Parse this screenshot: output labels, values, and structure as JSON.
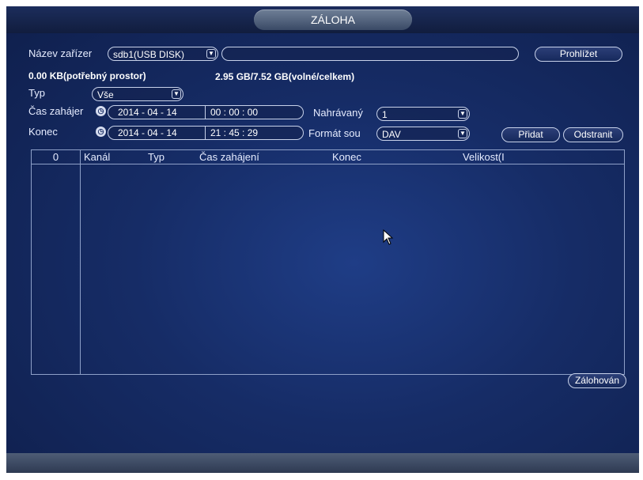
{
  "window": {
    "title": "ZÁLOHA"
  },
  "device": {
    "label": "Název zařízer",
    "selected": "sdb1(USB DISK)",
    "path_value": "",
    "browse_label": "Prohlížet"
  },
  "space": {
    "required": "0.00 KB(potřebný prostor)",
    "free_total": "2.95 GB/7.52 GB(volné/celkem)"
  },
  "type": {
    "label": "Typ",
    "selected": "Vše"
  },
  "start": {
    "label": "Čas zahájer",
    "date": "2014 - 04 - 14",
    "time": "00 : 00 : 00"
  },
  "end": {
    "label": "Konec",
    "date": "2014 - 04 - 14",
    "time": "21 : 45 : 29"
  },
  "recorder": {
    "label": "Nahrávaný",
    "selected": "1"
  },
  "format": {
    "label": "Formát sou",
    "selected": "DAV"
  },
  "actions": {
    "add_label": "Přidat",
    "remove_label": "Odstranit",
    "backup_label": "Zálohován"
  },
  "table": {
    "count": "0",
    "columns": [
      "Kanál",
      "Typ",
      "Čas zahájení",
      "Konec",
      "Velikost(I"
    ],
    "rows": []
  },
  "colors": {
    "background": "#162c66",
    "border": "#c8d2ea",
    "title_tab": "#5a6a84"
  },
  "icons": [
    "clock-icon",
    "chevron-down-icon",
    "mouse-cursor-icon"
  ]
}
